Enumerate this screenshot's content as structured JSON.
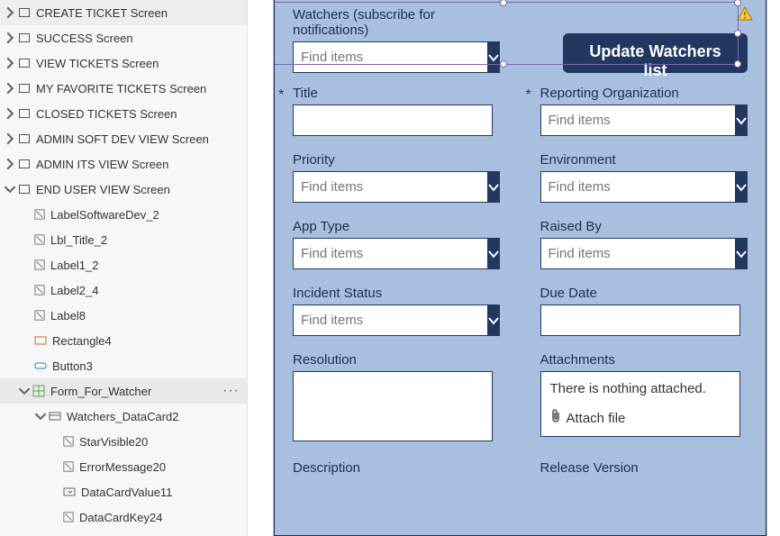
{
  "tree": {
    "screens": [
      "CREATE TICKET Screen",
      "SUCCESS Screen",
      "VIEW TICKETS Screen",
      "MY FAVORITE TICKETS Screen",
      "CLOSED TICKETS Screen",
      "ADMIN SOFT DEV VIEW Screen",
      "ADMIN ITS VIEW Screen"
    ],
    "expanded_screen": "END USER VIEW Screen",
    "controls": [
      "LabelSoftwareDev_2",
      "Lbl_Title_2",
      "Label1_2",
      "Label2_4",
      "Label8"
    ],
    "rectangle": "Rectangle4",
    "button": "Button3",
    "form": "Form_For_Watcher",
    "datacard": "Watchers_DataCard2",
    "dc_children": [
      "StarVisible20",
      "ErrorMessage20",
      "DataCardValue11",
      "DataCardKey24"
    ]
  },
  "form": {
    "watchers_label": "Watchers (subscribe for notifications)",
    "find_items": "Find items",
    "update_button": "Update Watchers list",
    "fields": {
      "title": "Title",
      "reporting_org": "Reporting Organization",
      "priority": "Priority",
      "environment": "Environment",
      "app_type": "App Type",
      "raised_by": "Raised By",
      "incident_status": "Incident Status",
      "due_date": "Due Date",
      "resolution": "Resolution",
      "attachments": "Attachments",
      "description": "Description",
      "release_version": "Release Version"
    },
    "attach_empty": "There is nothing attached.",
    "attach_action": "Attach file"
  }
}
